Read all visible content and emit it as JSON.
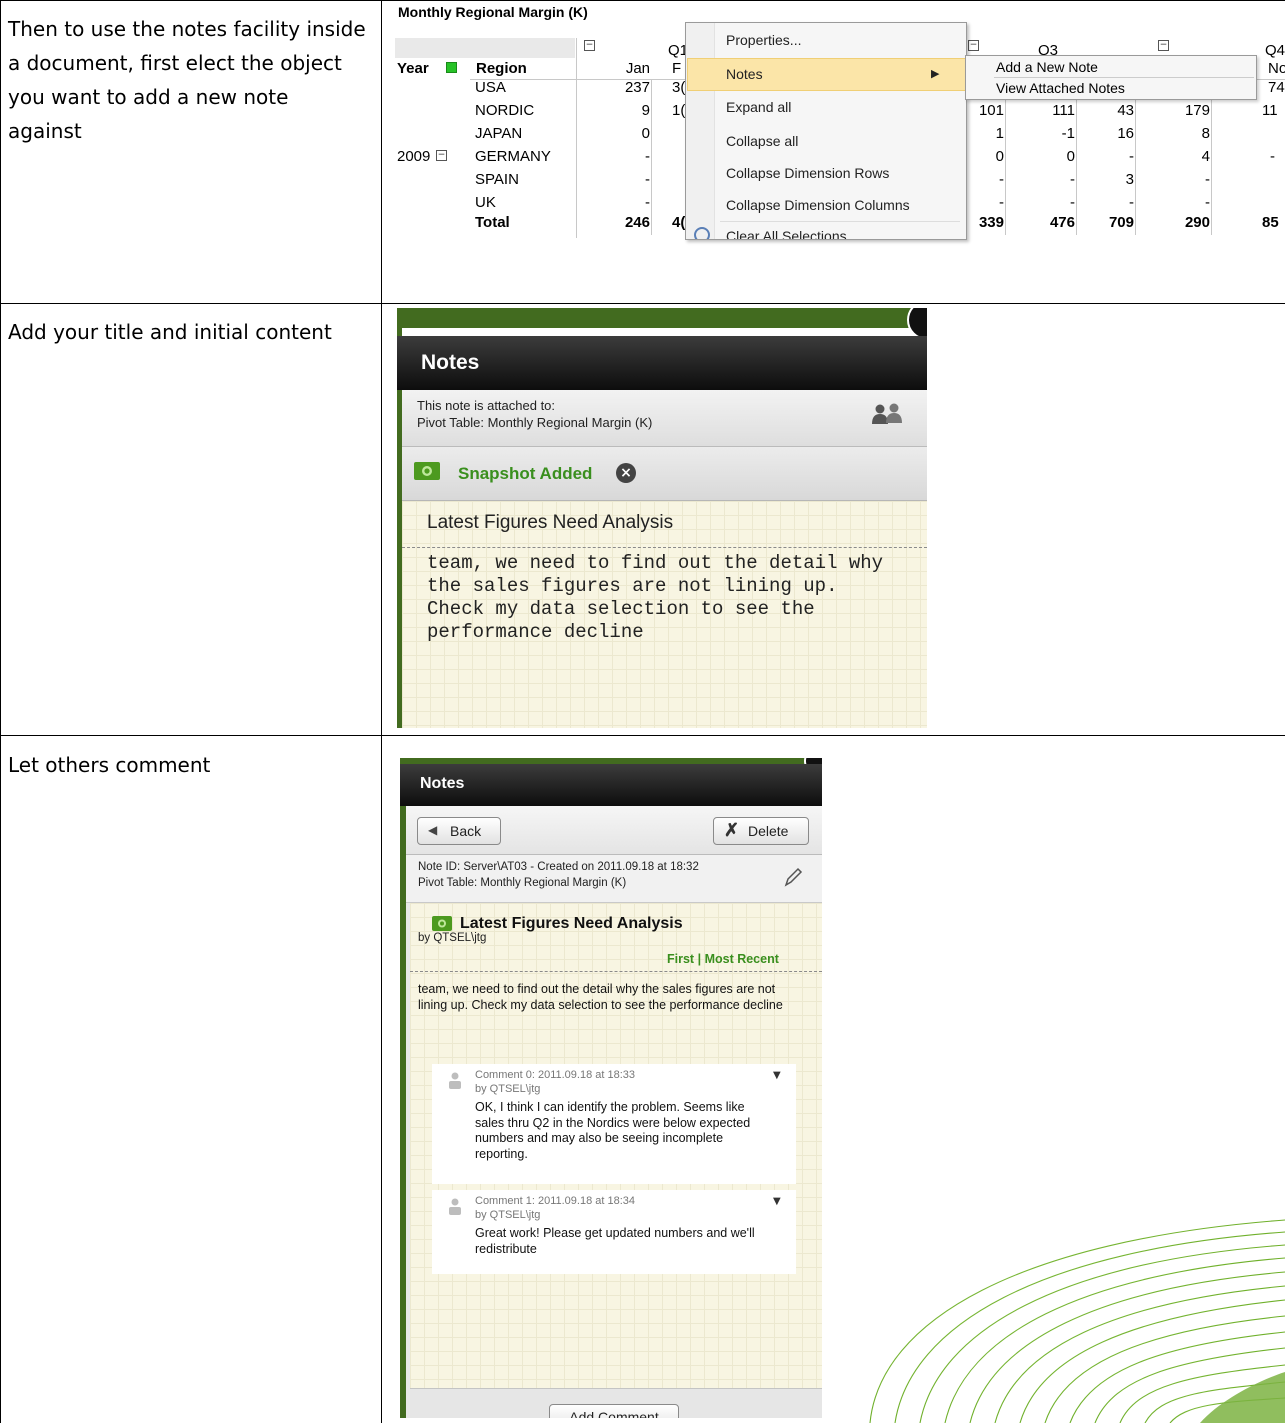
{
  "steps": [
    {
      "text": "Then to use the notes facility inside a document, first elect the object you want to add a new note against"
    },
    {
      "text": "Add your title and initial content"
    },
    {
      "text": "Let others comment"
    }
  ],
  "pivot": {
    "title": "Monthly Regional Margin (K)",
    "quarters": [
      "Q1",
      "Q3",
      "Q4"
    ],
    "col_year": "Year",
    "col_region": "Region",
    "year": "2009",
    "jan_header": "Jan",
    "feb_header_fragment": "F",
    "nov_fragment": "No",
    "regions": [
      "USA",
      "NORDIC",
      "JAPAN",
      "GERMANY",
      "SPAIN",
      "UK",
      "Total"
    ],
    "jan": [
      "237",
      "9",
      "0",
      "-",
      "-",
      "-",
      "246"
    ],
    "feb_fragment": [
      "3(",
      "1(",
      "",
      "",
      "",
      "",
      "4("
    ],
    "right_cols": [
      [
        "",
        "101",
        "1",
        "0",
        "-",
        "-",
        "339"
      ],
      [
        "",
        "111",
        "-1",
        "0",
        "-",
        "-",
        "476"
      ],
      [
        "",
        "43",
        "16",
        "-",
        "3",
        "-",
        "709"
      ],
      [
        "",
        "179",
        "8",
        "4",
        "-",
        "-",
        "290"
      ],
      [
        "",
        "11",
        "",
        "-",
        "",
        "",
        "85"
      ]
    ],
    "usa_right_fragment": "74"
  },
  "context_menu": {
    "items": [
      "Properties...",
      "Notes",
      "Expand all",
      "Collapse all",
      "Collapse Dimension Rows",
      "Collapse Dimension Columns",
      "Clear All Selections"
    ],
    "submenu": [
      "Add a New Note",
      "View Attached Notes"
    ]
  },
  "notes_panel_1": {
    "header": "Notes",
    "attached_line1": "This note is attached to:",
    "attached_line2": "Pivot Table: Monthly Regional Margin (K)",
    "snapshot": "Snapshot Added",
    "note_title": "Latest Figures Need Analysis",
    "note_body": "team, we need to find out the detail why the sales figures are not lining up.  Check my data selection to see the performance decline",
    "colors": {
      "header_bg": "#1a1a1a",
      "snapshot_green": "#3a8f1e",
      "frame_green": "#426b1f",
      "paper": "#f8f5e2"
    }
  },
  "notes_panel_2": {
    "header": "Notes",
    "back_label": "Back",
    "delete_label": "Delete",
    "meta_line1": "Note ID: Server\\AT03 - Created on 2011.09.18 at 18:32",
    "meta_line2": "Pivot Table: Monthly Regional Margin (K)",
    "note_title": "Latest Figures Need Analysis",
    "note_author": "by QTSEL\\jtg",
    "nav_first": "First",
    "nav_sep": "|",
    "nav_recent": "Most Recent",
    "note_body": "team, we need to find out the detail why the sales figures are not lining up.  Check my data selection to see the performance decline",
    "comments": [
      {
        "header": "Comment 0: 2011.09.18 at 18:33",
        "author": "by QTSEL\\jtg",
        "body": "OK, I think I can identify the problem.  Seems like sales thru Q2 in the Nordics were below expected numbers and may also be seeing incomplete reporting."
      },
      {
        "header": "Comment 1: 2011.09.18 at 18:34",
        "author": "by QTSEL\\jtg",
        "body": "Great work!  Please get updated numbers and we'll redistribute"
      }
    ],
    "add_comment": "Add Comment"
  }
}
